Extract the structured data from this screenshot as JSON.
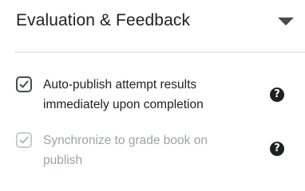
{
  "panel": {
    "title": "Evaluation & Feedback",
    "expanded": true
  },
  "options": [
    {
      "label": "Auto-publish attempt results immediately upon completion",
      "checked": true,
      "disabled": false,
      "help_icon": "question-circle-icon"
    },
    {
      "label": "Synchronize to grade book on publish",
      "checked": true,
      "disabled": true,
      "help_icon": "question-circle-icon"
    }
  ],
  "colors": {
    "text": "#202122",
    "disabled_text": "#9ea2a6",
    "checkbox_border": "#494c4e",
    "checkbox_disabled_border": "#c9ccd0",
    "divider": "#d3d9e3"
  }
}
